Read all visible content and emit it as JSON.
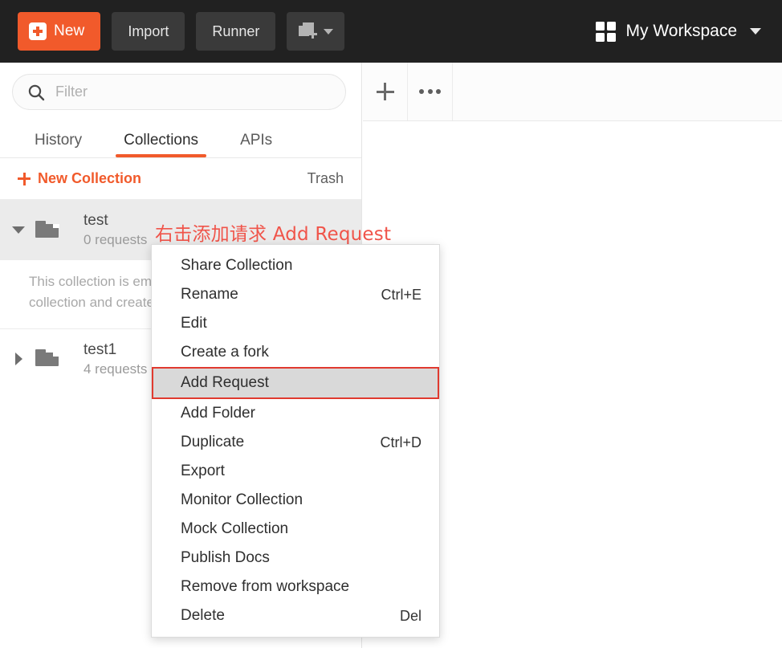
{
  "header": {
    "new_button": {
      "label": "New",
      "icon": "plus-square-icon",
      "color": "#f15a2b"
    },
    "import_button": "Import",
    "runner_button": "Runner",
    "new_tab_button": {
      "icon": "new-tab-icon",
      "caret": "chevron-down-icon"
    },
    "workspace": {
      "icon": "grid-icon",
      "label": "My Workspace",
      "caret": "chevron-down-icon"
    },
    "background": "#212121"
  },
  "sidebar": {
    "search": {
      "icon": "search-icon",
      "placeholder": "Filter",
      "value": ""
    },
    "tabs": [
      {
        "label": "History",
        "active": false
      },
      {
        "label": "Collections",
        "active": true
      },
      {
        "label": "APIs",
        "active": false
      }
    ],
    "active_tab_color": "#f15a2b",
    "subbar": {
      "new_collection_label": "New Collection",
      "new_collection_icon": "plus-icon",
      "trash_label": "Trash"
    },
    "collections": [
      {
        "name": "test",
        "requests": "0 requests",
        "expanded": true,
        "selected": true,
        "empty_note": "This collection is empty. Add requests to this collection and create..."
      },
      {
        "name": "test1",
        "requests": "4 requests",
        "expanded": false,
        "selected": false
      }
    ]
  },
  "main": {
    "new_tab_button_icon": "plus-icon",
    "more_button_icon": "ellipsis-icon"
  },
  "annotation": {
    "text": "右击添加请求 Add Request",
    "color": "#f0544a"
  },
  "context_menu": {
    "highlight_border_color": "#e03a2f",
    "highlight_background": "#d9d9d9",
    "items": [
      {
        "label": "Share Collection",
        "shortcut": "",
        "highlighted": false
      },
      {
        "label": "Rename",
        "shortcut": "Ctrl+E",
        "highlighted": false
      },
      {
        "label": "Edit",
        "shortcut": "",
        "highlighted": false
      },
      {
        "label": "Create a fork",
        "shortcut": "",
        "highlighted": false
      },
      {
        "label": "Add Request",
        "shortcut": "",
        "highlighted": true
      },
      {
        "label": "Add Folder",
        "shortcut": "",
        "highlighted": false
      },
      {
        "label": "Duplicate",
        "shortcut": "Ctrl+D",
        "highlighted": false
      },
      {
        "label": "Export",
        "shortcut": "",
        "highlighted": false
      },
      {
        "label": "Monitor Collection",
        "shortcut": "",
        "highlighted": false
      },
      {
        "label": "Mock Collection",
        "shortcut": "",
        "highlighted": false
      },
      {
        "label": "Publish Docs",
        "shortcut": "",
        "highlighted": false
      },
      {
        "label": "Remove from workspace",
        "shortcut": "",
        "highlighted": false
      },
      {
        "label": "Delete",
        "shortcut": "Del",
        "highlighted": false
      }
    ]
  }
}
